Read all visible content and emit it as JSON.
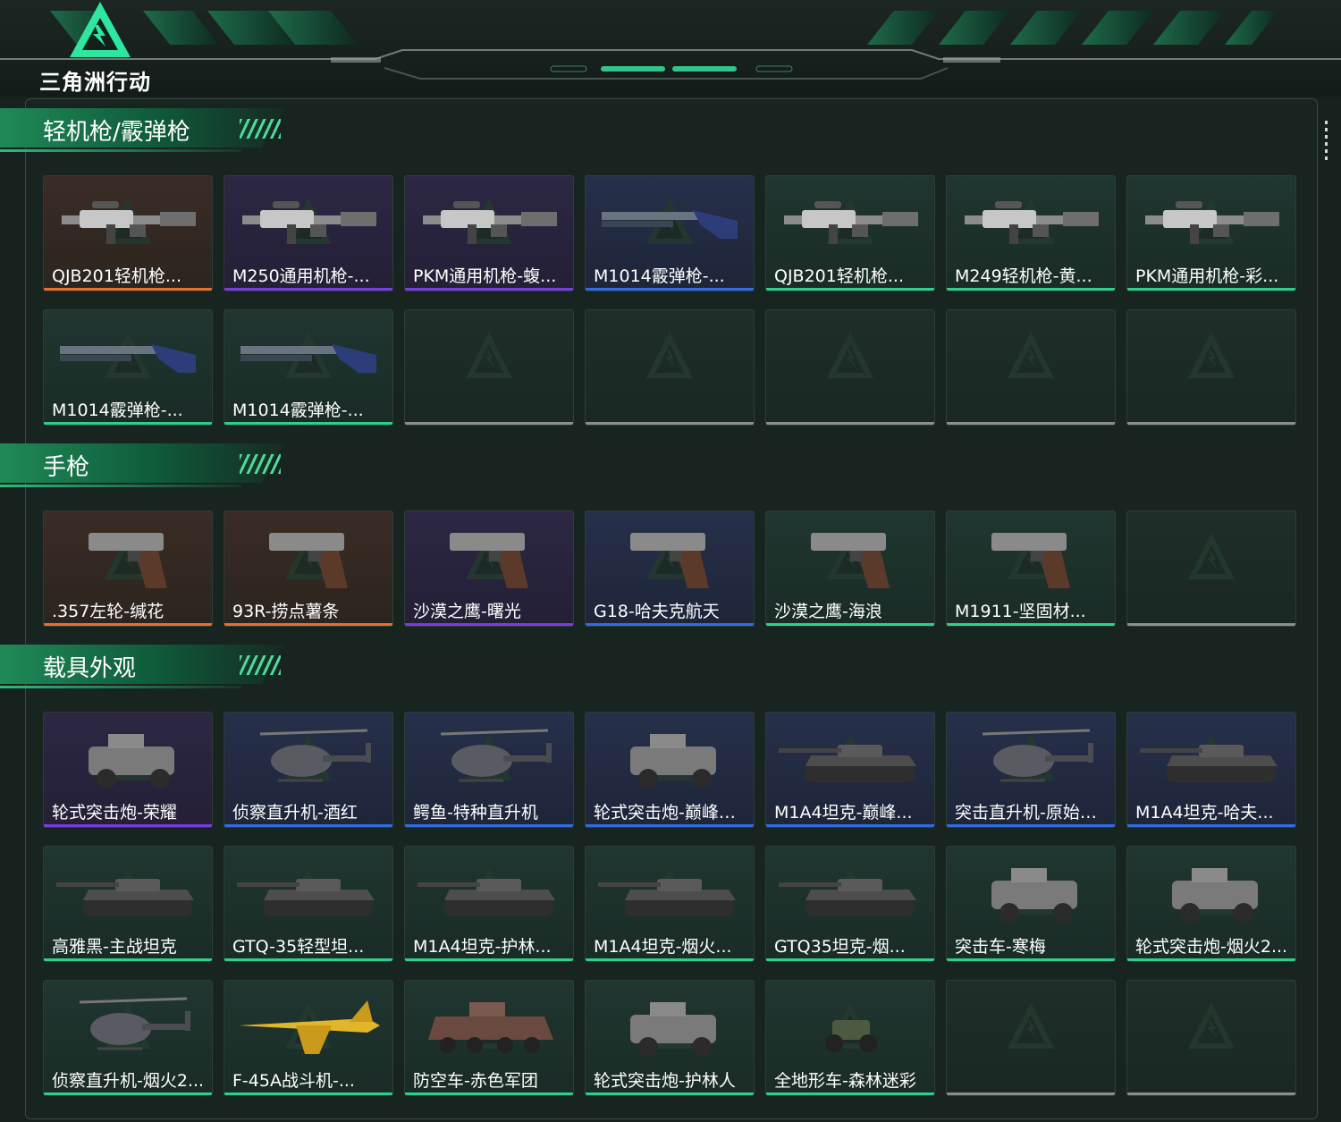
{
  "app": {
    "brand": "三角洲行动"
  },
  "colors": {
    "accent": "#2dbd78",
    "orange": "#e8702a",
    "purple": "#7a3ce0",
    "blue": "#2f6de0",
    "green": "#2fcf8a",
    "empty": "#8a8f8d"
  },
  "sections": [
    {
      "title": "轻机枪/霰弹枪"
    },
    {
      "title": "手枪"
    },
    {
      "title": "载具外观"
    }
  ],
  "cards": [
    {
      "name": "QJB201轻机枪...",
      "rarity": "orange",
      "icon": "lmg-icon"
    },
    {
      "name": "M250通用机枪-...",
      "rarity": "purple",
      "icon": "lmg-icon"
    },
    {
      "name": "PKM通用机枪-蝮...",
      "rarity": "purple",
      "icon": "lmg-icon"
    },
    {
      "name": "M1014霰弹枪-...",
      "rarity": "blue",
      "icon": "shotgun-icon"
    },
    {
      "name": "QJB201轻机枪...",
      "rarity": "green",
      "icon": "lmg-icon"
    },
    {
      "name": "M249轻机枪-黄...",
      "rarity": "green",
      "icon": "lmg-icon"
    },
    {
      "name": "PKM通用机枪-彩...",
      "rarity": "green",
      "icon": "lmg-icon"
    },
    {
      "name": "M1014霰弹枪-...",
      "rarity": "green",
      "icon": "shotgun-icon"
    },
    {
      "name": "M1014霰弹枪-...",
      "rarity": "green",
      "icon": "shotgun-icon"
    },
    {
      "name": "",
      "rarity": "empty",
      "icon": ""
    },
    {
      "name": "",
      "rarity": "empty",
      "icon": ""
    },
    {
      "name": "",
      "rarity": "empty",
      "icon": ""
    },
    {
      "name": "",
      "rarity": "empty",
      "icon": ""
    },
    {
      "name": "",
      "rarity": "empty",
      "icon": ""
    },
    {
      "name": ".357左轮-缄花",
      "rarity": "orange",
      "icon": "pistol-icon"
    },
    {
      "name": "93R-捞点薯条",
      "rarity": "orange",
      "icon": "pistol-icon"
    },
    {
      "name": "沙漠之鹰-曙光",
      "rarity": "purple",
      "icon": "pistol-icon"
    },
    {
      "name": "G18-哈夫克航天",
      "rarity": "blue",
      "icon": "pistol-icon"
    },
    {
      "name": "沙漠之鹰-海浪",
      "rarity": "green",
      "icon": "pistol-icon"
    },
    {
      "name": "M1911-坚固材...",
      "rarity": "green",
      "icon": "pistol-icon"
    },
    {
      "name": "",
      "rarity": "empty",
      "icon": ""
    },
    {
      "name": "轮式突击炮-荣耀",
      "rarity": "purple",
      "icon": "armored-car-icon"
    },
    {
      "name": "侦察直升机-酒红",
      "rarity": "blue",
      "icon": "helicopter-icon"
    },
    {
      "name": "鳄鱼-特种直升机",
      "rarity": "blue",
      "icon": "helicopter-icon"
    },
    {
      "name": "轮式突击炮-巅峰竞...",
      "rarity": "blue",
      "icon": "armored-car-icon"
    },
    {
      "name": "M1A4坦克-巅峰...",
      "rarity": "blue",
      "icon": "tank-icon"
    },
    {
      "name": "突击直升机-原始伪...",
      "rarity": "blue",
      "icon": "helicopter-icon"
    },
    {
      "name": "M1A4坦克-哈夫...",
      "rarity": "blue",
      "icon": "tank-icon"
    },
    {
      "name": "高雅黑-主战坦克",
      "rarity": "green",
      "icon": "tank-icon"
    },
    {
      "name": "GTQ-35轻型坦...",
      "rarity": "green",
      "icon": "tank-icon"
    },
    {
      "name": "M1A4坦克-护林...",
      "rarity": "green",
      "icon": "tank-icon"
    },
    {
      "name": "M1A4坦克-烟火...",
      "rarity": "green",
      "icon": "tank-icon"
    },
    {
      "name": "GTQ35坦克-烟...",
      "rarity": "green",
      "icon": "tank-icon"
    },
    {
      "name": "突击车-寒梅",
      "rarity": "green",
      "icon": "armored-car-icon"
    },
    {
      "name": "轮式突击炮-烟火2...",
      "rarity": "green",
      "icon": "armored-car-icon"
    },
    {
      "name": "侦察直升机-烟火2...",
      "rarity": "green",
      "icon": "helicopter-icon"
    },
    {
      "name": "F-45A战斗机-...",
      "rarity": "green",
      "icon": "jet-icon"
    },
    {
      "name": "防空车-赤色军团",
      "rarity": "green",
      "icon": "apc-icon"
    },
    {
      "name": "轮式突击炮-护林人",
      "rarity": "green",
      "icon": "armored-car-icon"
    },
    {
      "name": "全地形车-森林迷彩",
      "rarity": "green",
      "icon": "atv-icon"
    },
    {
      "name": "",
      "rarity": "empty",
      "icon": ""
    },
    {
      "name": "",
      "rarity": "empty",
      "icon": ""
    }
  ]
}
